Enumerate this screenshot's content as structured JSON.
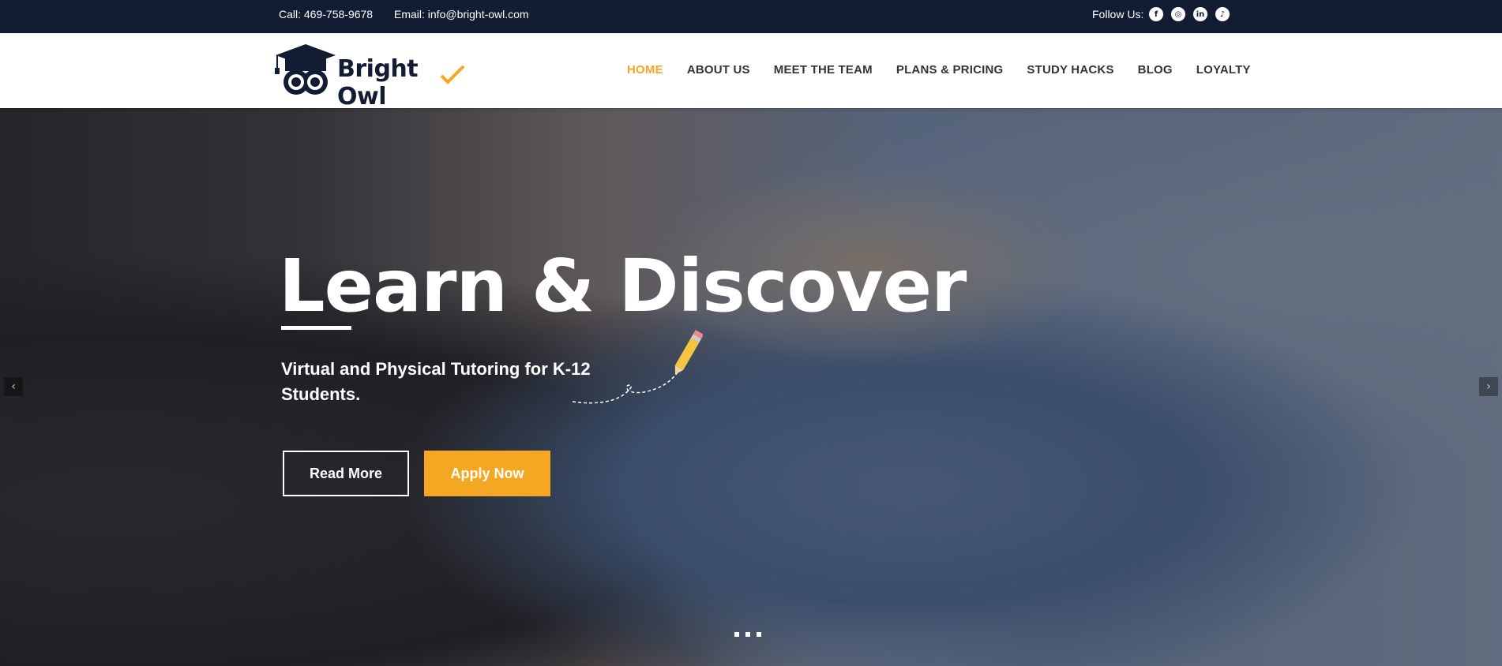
{
  "topbar": {
    "call": "Call: 469-758-9678",
    "email": "Email: info@bright-owl.com",
    "follow": "Follow Us:",
    "socials": [
      {
        "icon": "facebook-icon",
        "glyph": "f"
      },
      {
        "icon": "instagram-icon",
        "glyph": "◎"
      },
      {
        "icon": "linkedin-icon",
        "glyph": "in"
      },
      {
        "icon": "tiktok-icon",
        "glyph": "♪"
      }
    ]
  },
  "header": {
    "logo_text": "Bright Owl",
    "nav": [
      "HOME",
      "ABOUT US",
      "MEET THE TEAM",
      "PLANS & PRICING",
      "STUDY HACKS",
      "BLOG",
      "LOYALTY"
    ],
    "active": "HOME"
  },
  "hero": {
    "title": "Learn & Discover",
    "subtitle": "Virtual and Physical Tutoring for K-12 Students.",
    "read_more": "Read More",
    "apply_now": "Apply Now",
    "prev_arrow": "‹",
    "next_arrow": "›",
    "slide_count": 3
  },
  "colors": {
    "topbar_bg": "#121c33",
    "accent": "#f5a623",
    "brand_dark": "#121c33"
  }
}
